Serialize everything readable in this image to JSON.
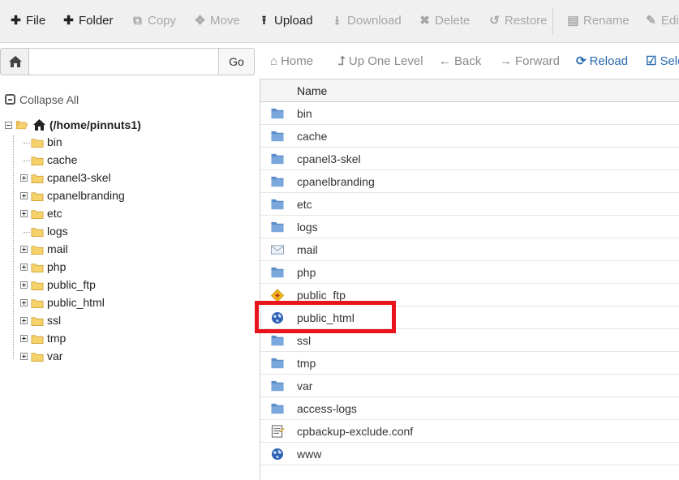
{
  "toolbar": {
    "buttons": [
      {
        "label": "File",
        "icon": "plus-icon",
        "enabled": true
      },
      {
        "label": "Folder",
        "icon": "plus-icon",
        "enabled": true
      },
      {
        "label": "Copy",
        "icon": "copy-icon",
        "enabled": false
      },
      {
        "label": "Move",
        "icon": "move-icon",
        "enabled": false
      },
      {
        "label": "Upload",
        "icon": "upload-icon",
        "enabled": true
      },
      {
        "label": "Download",
        "icon": "download-icon",
        "enabled": false
      },
      {
        "label": "Delete",
        "icon": "delete-icon",
        "enabled": false
      },
      {
        "label": "Restore",
        "icon": "restore-icon",
        "enabled": false
      },
      {
        "label": "Rename",
        "icon": "rename-icon",
        "enabled": false
      },
      {
        "label": "Edit",
        "icon": "edit-icon",
        "enabled": false
      }
    ]
  },
  "pathbar": {
    "input_value": "",
    "go_label": "Go"
  },
  "navbar": {
    "buttons": [
      {
        "label": "Home",
        "icon": "home-icon"
      },
      {
        "label": "Up One Level",
        "icon": "level-up-icon"
      },
      {
        "label": "Back",
        "icon": "arrow-left-icon"
      },
      {
        "label": "Forward",
        "icon": "arrow-right-icon"
      },
      {
        "label": "Reload",
        "icon": "reload-icon"
      },
      {
        "label": "Sele",
        "icon": "checkbox-icon"
      }
    ]
  },
  "tree": {
    "collapse_all_label": "Collapse All",
    "root_label": "(/home/pinnuts1)",
    "nodes": [
      {
        "label": "bin",
        "expandable": false
      },
      {
        "label": "cache",
        "expandable": false
      },
      {
        "label": "cpanel3-skel",
        "expandable": true
      },
      {
        "label": "cpanelbranding",
        "expandable": true
      },
      {
        "label": "etc",
        "expandable": true
      },
      {
        "label": "logs",
        "expandable": false
      },
      {
        "label": "mail",
        "expandable": true
      },
      {
        "label": "php",
        "expandable": true
      },
      {
        "label": "public_ftp",
        "expandable": true
      },
      {
        "label": "public_html",
        "expandable": true
      },
      {
        "label": "ssl",
        "expandable": true
      },
      {
        "label": "tmp",
        "expandable": true
      },
      {
        "label": "var",
        "expandable": true
      }
    ]
  },
  "filelist": {
    "header_name": "Name",
    "rows": [
      {
        "name": "bin",
        "icon": "folder-icon"
      },
      {
        "name": "cache",
        "icon": "folder-icon"
      },
      {
        "name": "cpanel3-skel",
        "icon": "folder-icon"
      },
      {
        "name": "cpanelbranding",
        "icon": "folder-icon"
      },
      {
        "name": "etc",
        "icon": "folder-icon"
      },
      {
        "name": "logs",
        "icon": "folder-icon"
      },
      {
        "name": "mail",
        "icon": "mail-folder-icon"
      },
      {
        "name": "php",
        "icon": "folder-icon"
      },
      {
        "name": "public_ftp",
        "icon": "ftp-folder-icon"
      },
      {
        "name": "public_html",
        "icon": "web-globe-icon",
        "highlighted": true
      },
      {
        "name": "ssl",
        "icon": "folder-icon"
      },
      {
        "name": "tmp",
        "icon": "folder-icon"
      },
      {
        "name": "var",
        "icon": "folder-icon"
      },
      {
        "name": "access-logs",
        "icon": "folder-icon"
      },
      {
        "name": "cpbackup-exclude.conf",
        "icon": "text-file-icon"
      },
      {
        "name": "www",
        "icon": "web-globe-icon"
      }
    ]
  },
  "colors": {
    "highlight": "#e8131b",
    "link_blue": "#2a6bb0",
    "folder_blue": "#5b8ec9",
    "tree_folder_yellow": "#f2c94c"
  }
}
